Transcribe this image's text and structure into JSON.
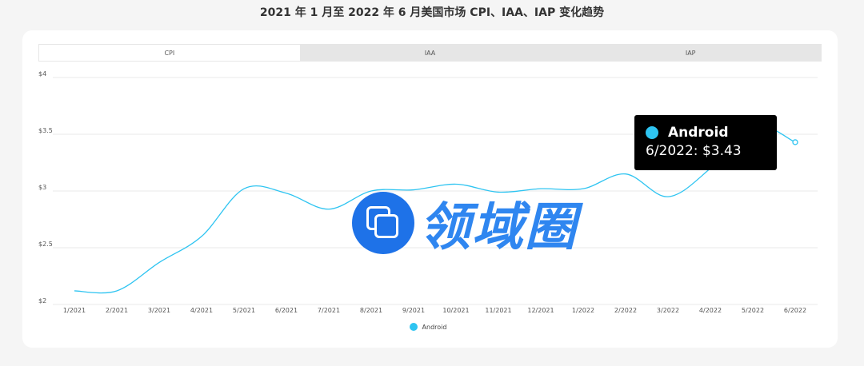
{
  "page": {
    "title": "2021 年 1 月至 2022 年 6 月美国市场 CPI、IAA、IAP 变化趋势"
  },
  "tabs": [
    {
      "label": "CPI",
      "active": true
    },
    {
      "label": "IAA",
      "active": false
    },
    {
      "label": "IAP",
      "active": false
    }
  ],
  "tooltip": {
    "series": "Android",
    "value_text": "6/2022: $3.43"
  },
  "watermark": {
    "text": "领域圈"
  },
  "colors": {
    "series": "#2ec4f1",
    "grid": "#e8e8e8",
    "axis_text": "#555555"
  },
  "chart_data": {
    "type": "line",
    "categories": [
      "1/2021",
      "2/2021",
      "3/2021",
      "4/2021",
      "5/2021",
      "6/2021",
      "7/2021",
      "8/2021",
      "9/2021",
      "10/2021",
      "11/2021",
      "12/2021",
      "1/2022",
      "2/2022",
      "3/2022",
      "4/2022",
      "5/2022",
      "6/2022"
    ],
    "y_ticks": [
      "$2",
      "$2.5",
      "$3",
      "$3.5",
      "$4"
    ],
    "ylim": [
      2,
      4
    ],
    "grid": true,
    "legend_position": "bottom",
    "series": [
      {
        "name": "Android",
        "values": [
          2.12,
          2.12,
          2.37,
          2.6,
          3.02,
          2.98,
          2.84,
          3.0,
          3.01,
          3.06,
          2.99,
          3.02,
          3.02,
          3.15,
          2.95,
          3.2,
          3.58,
          3.43
        ]
      }
    ]
  }
}
